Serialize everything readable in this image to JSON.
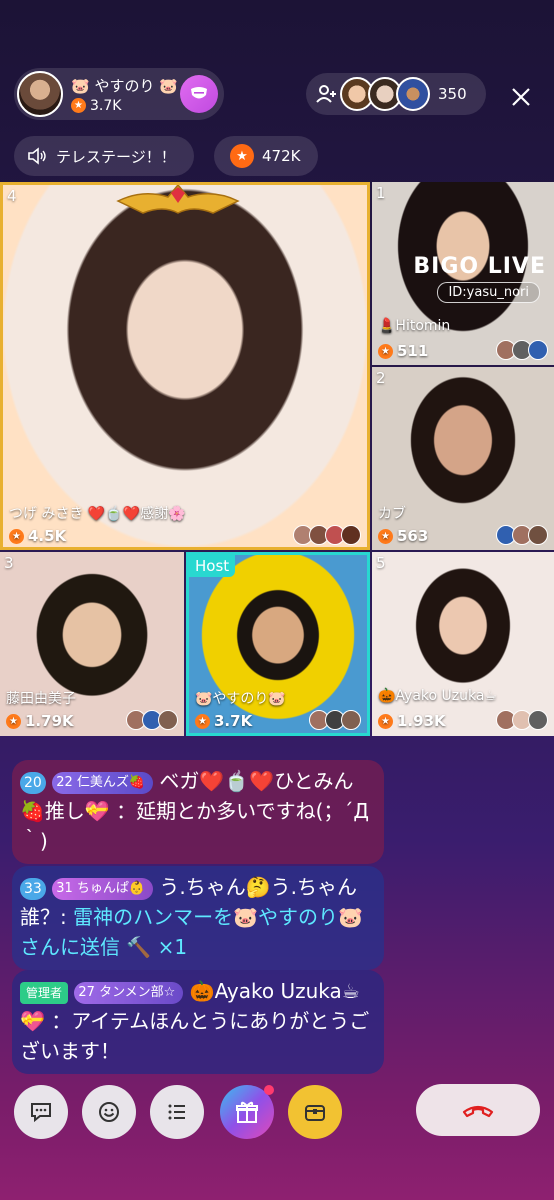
{
  "host": {
    "name": "🐷 やすのり 🐷",
    "score": "3.7K"
  },
  "viewers": {
    "count": "350"
  },
  "stage": {
    "title": "テレステージ！！",
    "beans": "472K"
  },
  "tiles": [
    {
      "num": "4",
      "name": "つげ みさき ❤️🍵❤️感謝🌸",
      "score": "4.5K"
    },
    {
      "num": "1",
      "name": "💄Hitomin",
      "score": "511",
      "watermark": "BIGO LIVE",
      "id": "ID:yasu_nori"
    },
    {
      "num": "2",
      "name": "カブ",
      "score": "563"
    },
    {
      "num": "3",
      "name": "藤田由美子",
      "score": "1.79K"
    },
    {
      "host_tag": "Host",
      "name": "🐷やすのり🐷",
      "score": "3.7K"
    },
    {
      "num": "5",
      "name": "🎃Ayako Uzuka☕",
      "score": "1.93K"
    }
  ],
  "chat": [
    {
      "level": "20",
      "badge_level": "22",
      "badge": "仁美んズ🍓",
      "text_a": "ベガ❤️🍵❤️ひとみん🍓推し💝",
      "text_b": "：延期とか多いですね(；´Д｀)"
    },
    {
      "level": "33",
      "badge_level": "31",
      "badge": "ちゅんぱ👶",
      "text_a": "う.ちゃん🤔う.ちゃん誰？: ",
      "text_b": "雷神のハンマーを🐷やすのり🐷さんに送信",
      "text_c": "×1"
    },
    {
      "admin": "管理者",
      "badge_level": "27",
      "badge": "タンメン部☆",
      "text_a": "🎃Ayako Uzuka☕💝",
      "text_b": "：アイテムほんとうにありがとうございます！"
    }
  ]
}
